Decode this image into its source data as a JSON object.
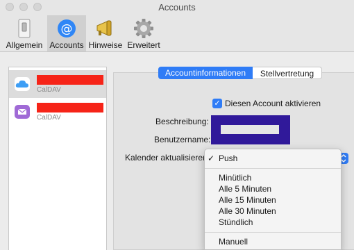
{
  "window": {
    "title": "Accounts"
  },
  "toolbar": {
    "items": [
      {
        "label": "Allgemein"
      },
      {
        "label": "Accounts"
      },
      {
        "label": "Hinweise"
      },
      {
        "label": "Erweitert"
      }
    ],
    "selected": "Accounts"
  },
  "sidebar": {
    "accounts": [
      {
        "type": "CalDAV",
        "icon": "icloud-icon"
      },
      {
        "type": "CalDAV",
        "icon": "mail-icon"
      }
    ]
  },
  "tabs": [
    {
      "label": "Accountinformationen",
      "selected": true
    },
    {
      "label": "Stellvertretung",
      "selected": false
    }
  ],
  "form": {
    "enable_label": "Diesen Account aktivieren",
    "enable_checked": true,
    "beschreibung_label": "Beschreibung:",
    "benutzername_label": "Benutzername:",
    "refresh_label": "Kalender aktualisieren:"
  },
  "menu": {
    "check_mark": "✓",
    "items": [
      {
        "label": "Push",
        "checked": true
      },
      {
        "label": "Minütlich"
      },
      {
        "label": "Alle 5 Minuten"
      },
      {
        "label": "Alle 15 Minuten"
      },
      {
        "label": "Alle 30 Minuten"
      },
      {
        "label": "Stündlich"
      },
      {
        "label": "Manuell"
      }
    ]
  },
  "colors": {
    "accent": "#2f7cf6",
    "redaction": "#f62418",
    "redaction_box": "#30199a"
  }
}
